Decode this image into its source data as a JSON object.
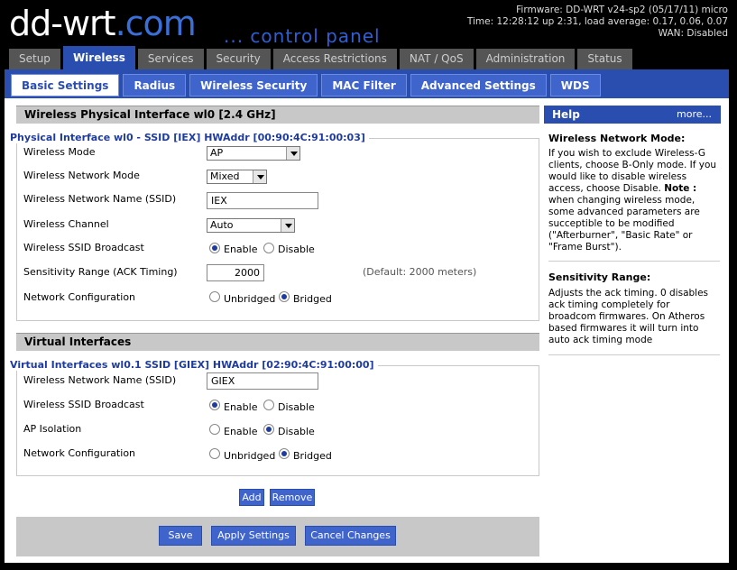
{
  "header": {
    "logo_dd": "dd-",
    "logo_wrt": "wrt",
    "logo_dot": ".com",
    "tagline": "... control panel",
    "firmware": "Firmware: DD-WRT v24-sp2 (05/17/11) micro",
    "time": "Time: 12:28:12 up 2:31, load average: 0.17, 0.06, 0.07",
    "wan": "WAN: Disabled"
  },
  "main_tabs": [
    "Setup",
    "Wireless",
    "Services",
    "Security",
    "Access Restrictions",
    "NAT / QoS",
    "Administration",
    "Status"
  ],
  "sub_tabs": [
    "Basic Settings",
    "Radius",
    "Wireless Security",
    "MAC Filter",
    "Advanced Settings",
    "WDS"
  ],
  "physical": {
    "section_title": "Wireless Physical Interface wl0 [2.4 GHz]",
    "legend": "Physical Interface wl0 - SSID [IEX] HWAddr [00:90:4C:91:00:03]",
    "mode_label": "Wireless Mode",
    "mode_value": "AP",
    "netmode_label": "Wireless Network Mode",
    "netmode_value": "Mixed",
    "ssid_label": "Wireless Network Name (SSID)",
    "ssid_value": "IEX",
    "channel_label": "Wireless Channel",
    "channel_value": "Auto",
    "broadcast_label": "Wireless SSID Broadcast",
    "broadcast_enable": "Enable",
    "broadcast_disable": "Disable",
    "sens_label": "Sensitivity Range (ACK Timing)",
    "sens_value": "2000",
    "sens_default": "(Default: 2000 meters)",
    "netconf_label": "Network Configuration",
    "netconf_unbridged": "Unbridged",
    "netconf_bridged": "Bridged"
  },
  "virtual": {
    "section_title": "Virtual Interfaces",
    "legend": "Virtual Interfaces wl0.1 SSID [GIEX] HWAddr [02:90:4C:91:00:00]",
    "ssid_label": "Wireless Network Name (SSID)",
    "ssid_value": "GIEX",
    "broadcast_label": "Wireless SSID Broadcast",
    "broadcast_enable": "Enable",
    "broadcast_disable": "Disable",
    "isolation_label": "AP Isolation",
    "isolation_enable": "Enable",
    "isolation_disable": "Disable",
    "netconf_label": "Network Configuration",
    "netconf_unbridged": "Unbridged",
    "netconf_bridged": "Bridged"
  },
  "buttons": {
    "add": "Add",
    "remove": "Remove",
    "save": "Save",
    "apply": "Apply Settings",
    "cancel": "Cancel Changes"
  },
  "help": {
    "title": "Help",
    "more": "more...",
    "mode_head": "Wireless Network Mode:",
    "mode_body": "If you wish to exclude Wireless-G clients, choose B-Only mode. If you would like to disable wireless access, choose Disable.",
    "mode_note_label": "Note :",
    "mode_note": " when changing wireless mode, some advanced parameters are succeptible to be modified (\"Afterburner\", \"Basic Rate\" or \"Frame Burst\").",
    "sens_head": "Sensitivity Range:",
    "sens_body": "Adjusts the ack timing. 0 disables ack timing completely for broadcom firmwares. On Atheros based firmwares it will turn into auto ack timing mode"
  },
  "colors": {
    "accent": "#2a4db0",
    "legend_text": "#1f3c9c",
    "section_bg": "#c8c8c8"
  }
}
